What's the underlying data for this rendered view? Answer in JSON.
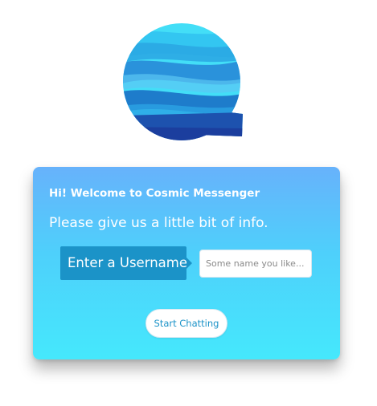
{
  "welcome_title": "Hi! Welcome to Cosmic Messenger",
  "info_prompt": "Please give us a little bit of info.",
  "username": {
    "label": "Enter a Username",
    "placeholder": "Some name you like...",
    "value": ""
  },
  "start_button_label": "Start Chatting",
  "logo": {
    "icon": "speech-bubble-logo",
    "colors": [
      "#3fe0f8",
      "#2eb8ef",
      "#1e8ed6",
      "#1d63b5",
      "#1b3b9c"
    ]
  },
  "card_gradient": [
    "#67b2fb",
    "#45e8fc"
  ]
}
